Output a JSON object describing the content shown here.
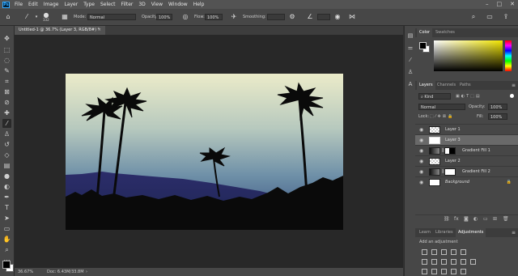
{
  "menubar": {
    "logo": "Ps",
    "items": [
      "File",
      "Edit",
      "Image",
      "Layer",
      "Type",
      "Select",
      "Filter",
      "3D",
      "View",
      "Window",
      "Help"
    ]
  },
  "options": {
    "brush_size": "332",
    "mode_label": "Mode:",
    "mode_value": "Normal",
    "opacity_label": "Opacity:",
    "opacity_value": "100%",
    "flow_label": "Flow:",
    "flow_value": "100%",
    "smoothing_label": "Smoothing:"
  },
  "document": {
    "tab_title": "Untitled-1 @ 36.7% (Layer 3, RGB/8#) *"
  },
  "status": {
    "zoom": "36.67%",
    "doc": "Doc: 6.43M/33.8M"
  },
  "color_panel": {
    "tabs": [
      "Color",
      "Swatches"
    ]
  },
  "layers_panel": {
    "tabs": [
      "Layers",
      "Channels",
      "Paths"
    ],
    "filter_kind": "Kind",
    "blend_mode": "Normal",
    "opacity_label": "Opacity:",
    "opacity_value": "100%",
    "lock_label": "Lock:",
    "fill_label": "Fill:",
    "fill_value": "100%",
    "layers": [
      {
        "name": "Layer 1",
        "type": "pixel",
        "selected": false
      },
      {
        "name": "Layer 3",
        "type": "pixel",
        "selected": true
      },
      {
        "name": "Gradient Fill 1",
        "type": "gradient",
        "selected": false
      },
      {
        "name": "Layer 2",
        "type": "pixel",
        "selected": false
      },
      {
        "name": "Gradient Fill 2",
        "type": "gradient",
        "selected": false
      },
      {
        "name": "Background",
        "type": "background",
        "selected": false
      }
    ]
  },
  "bottom_panel": {
    "tabs": [
      "Learn",
      "Libraries",
      "Adjustments"
    ],
    "add_adjustment": "Add an adjustment"
  },
  "colors": {
    "accent": "#31a8ff",
    "panel": "#474747",
    "foreground": "#000000",
    "background_color": "#ffffff"
  }
}
